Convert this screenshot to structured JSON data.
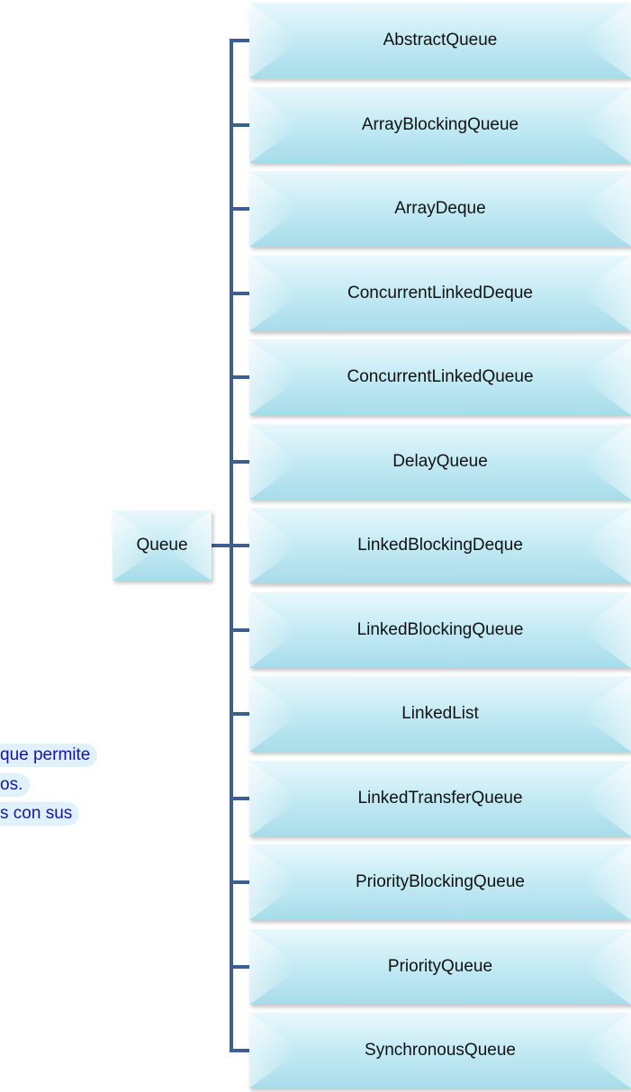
{
  "diagram": {
    "root": {
      "label": "Queue"
    },
    "children": [
      {
        "label": "AbstractQueue"
      },
      {
        "label": "ArrayBlockingQueue"
      },
      {
        "label": "ArrayDeque"
      },
      {
        "label": "ConcurrentLinkedDeque"
      },
      {
        "label": "ConcurrentLinkedQueue"
      },
      {
        "label": "DelayQueue"
      },
      {
        "label": "LinkedBlockingDeque"
      },
      {
        "label": "LinkedBlockingQueue"
      },
      {
        "label": "LinkedList"
      },
      {
        "label": "LinkedTransferQueue"
      },
      {
        "label": "PriorityBlockingQueue"
      },
      {
        "label": "PriorityQueue"
      },
      {
        "label": "SynchronousQueue"
      }
    ]
  },
  "side_text": {
    "line1": "que permite",
    "line2": "os.",
    "line3": "s con sus"
  },
  "colors": {
    "connector": "#3d5f8f",
    "box_fill": "#c3eaf4",
    "side_text": "#1515a6",
    "side_text_bg": "#dff2fb"
  }
}
